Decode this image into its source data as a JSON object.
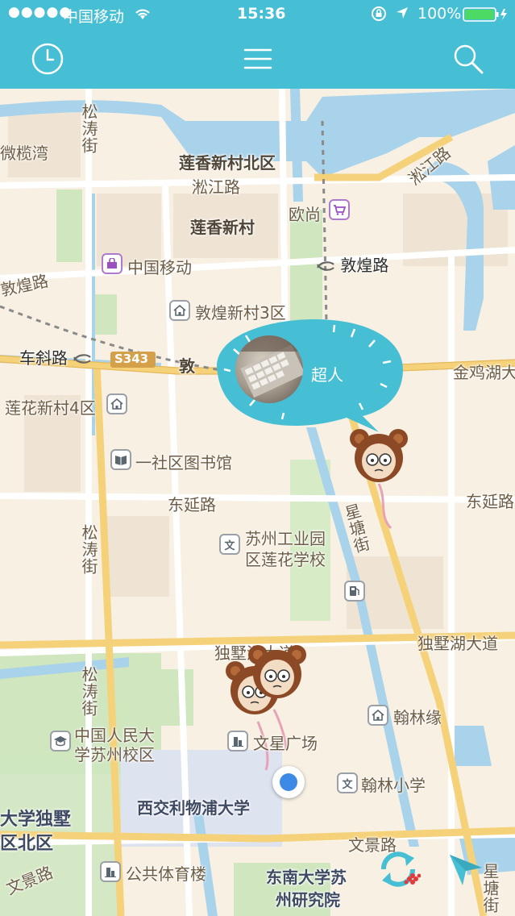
{
  "status_bar": {
    "signal": "●●●●●",
    "carrier": "中国移动",
    "time": "15:36",
    "battery": "100%"
  },
  "nav": {
    "history_icon": "clock-icon",
    "menu_icon": "menu-icon",
    "search_icon": "search-icon"
  },
  "map": {
    "labels": {
      "shuhe": "微榄湾",
      "songtaojie_top": "松涛街",
      "lianxiang_north": "莲香新村北区",
      "songjiang_lu": "淞江路",
      "songjiang_lu_ne": "淞江路",
      "auchan": "欧尚",
      "lianxiang": "莲香新村",
      "cmcc": "中国移动",
      "dunhuang_lu_w": "敦煌路",
      "dunhuang_lu_e": "敦煌路",
      "dunhuang_sanqu": "敦煌新村3区",
      "chexie_lu": "车斜路",
      "s343": "S343",
      "dun_partial": "敦",
      "jinjihu": "金鸡湖大",
      "lianhua4": "莲花新村4区",
      "library": "一社区图书馆",
      "dongyan_lu_w": "东延路",
      "dongyan_lu_e": "东延路",
      "songtaojie_mid": "松涛街",
      "xingtangjie": "星塘街",
      "school_line1": "苏州工业园",
      "school_line2": "区莲花学校",
      "dushuhu_ave_w": "独墅湖大道",
      "dushuhu_ave_e": "独墅湖大道",
      "songtaojie_low": "松涛街",
      "renmin_line1": "中国人民大",
      "renmin_line2": "学苏州校区",
      "hanlin_yuan": "翰林缘",
      "wenxing": "文星广场",
      "hanlin_school": "翰林小学",
      "xjtlu": "西交利物浦大学",
      "dushu_line1": "大学独墅",
      "dushu_line2": "区北区",
      "wenjing_lu_e": "文景路",
      "wenjing_lu_w": "文景路",
      "gym": "公共体育楼",
      "seu_line1": "东南大学苏",
      "seu_line2": "州研究院",
      "xingtangjie_low": "星塘街"
    },
    "user_bubble": {
      "name": "超人"
    },
    "controls": {
      "refresh_icon": "refresh-icon",
      "locate_icon": "locate-arrow-icon"
    },
    "colors": {
      "accent": "#46bfd4",
      "road_main": "#f5d27a",
      "water": "#a9d3ea",
      "green": "#cfe6bf"
    }
  }
}
